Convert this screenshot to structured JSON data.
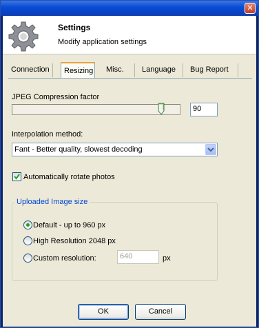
{
  "window": {
    "close_glyph": "✕"
  },
  "header": {
    "icon": "gear-icon",
    "title": "Settings",
    "subtitle": "Modify application settings"
  },
  "tabs": [
    {
      "label": "Connection",
      "active": false
    },
    {
      "label": "Resizing",
      "active": true
    },
    {
      "label": "Misc.",
      "active": false
    },
    {
      "label": "Language",
      "active": false
    },
    {
      "label": "Bug Report",
      "active": false
    }
  ],
  "resizing": {
    "jpeg_label": "JPEG Compression factor",
    "jpeg_value": "90",
    "jpeg_slider_percent": 90,
    "interp_label": "Interpolation method:",
    "interp_selected": "Fant - Better quality, slowest decoding",
    "auto_rotate_label": "Automatically rotate photos",
    "auto_rotate_checked": true,
    "group_title": "Uploaded Image size",
    "options": [
      {
        "label": "Default - up to 960 px",
        "selected": true
      },
      {
        "label": "High Resolution 2048 px",
        "selected": false
      },
      {
        "label": "Custom resolution:",
        "selected": false
      }
    ],
    "custom_value": "640",
    "custom_unit": "px"
  },
  "buttons": {
    "ok": "OK",
    "cancel": "Cancel"
  },
  "colors": {
    "title_bar": "#0a4fd5",
    "dialog_bg": "#ece9d8",
    "group_title": "#0046d5",
    "radio_dot": "#21a121"
  }
}
